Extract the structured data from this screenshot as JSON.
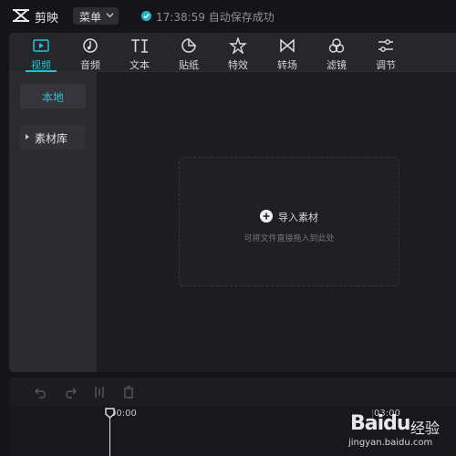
{
  "app": {
    "name": "剪映",
    "logo_icon": "capcut-logo-icon"
  },
  "header": {
    "menu_label": "菜单",
    "status_time": "17:38:59",
    "status_text": "自动保存成功",
    "status_color": "#2ab3c8"
  },
  "tabs": [
    {
      "label": "视频",
      "icon": "play-rectangle-icon",
      "active": true
    },
    {
      "label": "音频",
      "icon": "music-note-icon",
      "active": false
    },
    {
      "label": "文本",
      "icon": "text-icon",
      "active": false
    },
    {
      "label": "贴纸",
      "icon": "sticker-icon",
      "active": false
    },
    {
      "label": "特效",
      "icon": "sparkle-star-icon",
      "active": false
    },
    {
      "label": "转场",
      "icon": "bowtie-transition-icon",
      "active": false
    },
    {
      "label": "滤镜",
      "icon": "filter-circles-icon",
      "active": false
    },
    {
      "label": "调节",
      "icon": "sliders-icon",
      "active": false
    }
  ],
  "accent_color": "#22c3d6",
  "sidebar": {
    "local_label": "本地",
    "library_label": "素材库"
  },
  "dropzone": {
    "import_label": "导入素材",
    "hint": "可将文件直接拖入到此处"
  },
  "timeline": {
    "tools": [
      "undo-icon",
      "redo-icon",
      "split-icon",
      "delete-icon"
    ],
    "time_start": "00:00",
    "time_mark": "03:00"
  },
  "watermark": {
    "brand": "Baidu",
    "brand_cn": "经验",
    "site": "jingyan.baidu.com"
  }
}
